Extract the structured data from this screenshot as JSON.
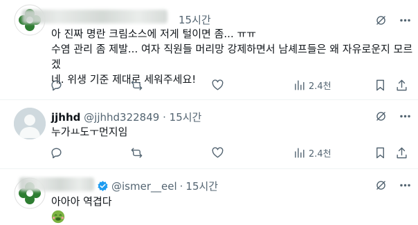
{
  "tweets": [
    {
      "time": "15시간",
      "lines": [
        "아 진짜 명란 크림소스에 저게 털이면 좀... ㅠㅠ",
        "수염 관리 좀 제발... 여자 직원들 머리망 강제하면서 남셰프들은 왜 자유로운지 모르겠",
        "네. 위생 기준 제대로 세워주세요!"
      ],
      "views": "2.4천"
    },
    {
      "name": "jjhhd",
      "handle": "@jjhhd322849",
      "dot": "·",
      "time": "15시간",
      "lines": [
        "누가ㅛ도ㅜ먼지임"
      ],
      "views": "2.4천"
    },
    {
      "handle": "@ismer__eel",
      "dot": "·",
      "time": "15시간",
      "lines": [
        "아아아 역겹다"
      ]
    }
  ],
  "icons": {
    "reply": "reply-icon",
    "retweet": "retweet-icon",
    "like": "heart-icon",
    "views": "views-icon",
    "bookmark": "bookmark-icon",
    "share": "share-icon",
    "grok": "grok-icon",
    "more": "more-icon",
    "verified": "verified-badge-icon",
    "emoji": "nauseated-face-emoji"
  },
  "colors": {
    "text": "#0f1419",
    "muted": "#536471",
    "divider": "#eff3f4",
    "verified": "#1d9bf0",
    "clover": "#2e7d32"
  }
}
